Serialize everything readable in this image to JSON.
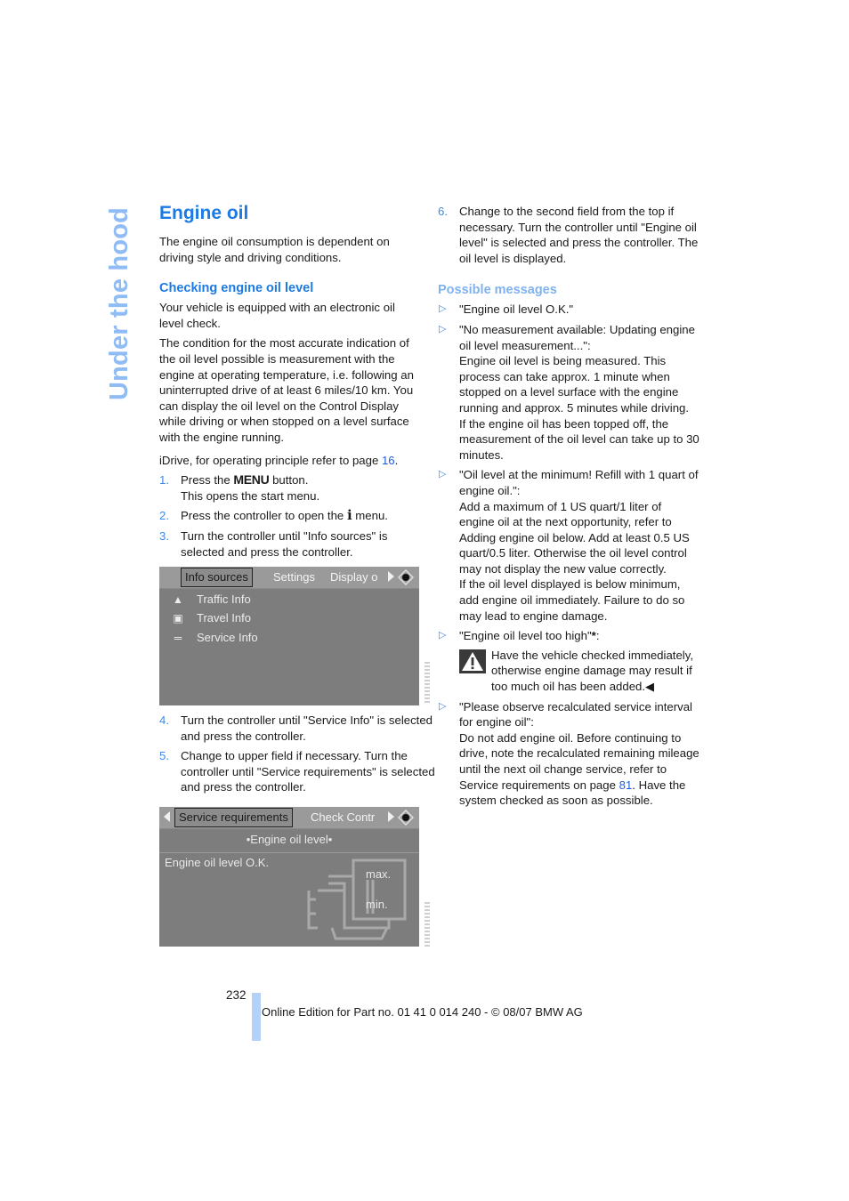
{
  "side_title": "Under the hood",
  "left": {
    "heading": "Engine oil",
    "intro": "The engine oil consumption is dependent on driving style and driving conditions.",
    "subheading": "Checking engine oil level",
    "para1": "Your vehicle is equipped with an electronic oil level check.",
    "para2": "The condition for the most accurate indication of the oil level possible is measurement with the engine at operating temperature, i.e. following an uninterrupted drive of at least 6 miles/10 km. You can display the oil level on the Control Display while driving or when stopped on a level surface with the engine running.",
    "idrive_text": "iDrive, for operating principle refer to page ",
    "idrive_page": "16",
    "idrive_end": ".",
    "steps": [
      {
        "num": "1.",
        "pre": "Press the ",
        "menu_word": "MENU",
        "post": " button.",
        "line2": "This opens the start menu."
      },
      {
        "num": "2.",
        "pre": "Press the controller to open the ",
        "icon": "i",
        "post": " menu."
      },
      {
        "num": "3.",
        "text": "Turn the controller until \"Info sources\" is selected and press the controller."
      },
      {
        "num": "4.",
        "text": "Turn the controller until \"Service Info\" is selected and press the controller."
      },
      {
        "num": "5.",
        "text": "Change to upper field if necessary. Turn the controller until \"Service requirements\" is selected and press the controller."
      }
    ]
  },
  "screen1": {
    "tabs": [
      "Info sources",
      "Settings",
      "Display o"
    ],
    "items": [
      {
        "icon": "traffic-info-icon",
        "label": "Traffic Info"
      },
      {
        "icon": "travel-info-icon",
        "label": "Travel Info"
      },
      {
        "icon": "service-info-icon",
        "label": "Service Info"
      }
    ]
  },
  "screen2": {
    "tabs": [
      "Service requirements",
      "Check Contr"
    ],
    "subtitle": "•Engine oil level•",
    "status": "Engine oil level O.K.",
    "gauge_max": "max.",
    "gauge_min": "min."
  },
  "right": {
    "step6": {
      "num": "6.",
      "text": "Change to the second field from the top if necessary. Turn the controller until \"Engine oil level\" is selected and press the controller. The oil level is displayed."
    },
    "subheading": "Possible messages",
    "bullet_glyph": "▷",
    "messages": [
      {
        "title": "\"Engine oil level O.K.\""
      },
      {
        "title": "\"No measurement available: Updating engine oil level measurement...\":",
        "body1": "Engine oil level is being measured. This process can take approx. 1 minute when stopped on a level surface with the engine running and approx. 5 minutes while driving.",
        "body2": "If the engine oil has been topped off, the measurement of the oil level can take up to 30 minutes."
      },
      {
        "title": "\"Oil level at the minimum! Refill with 1 quart of engine oil.\":",
        "body1": "Add a maximum of 1 US quart/1 liter of engine oil at the next opportunity, refer to Adding engine oil below. Add at least 0.5 US quart/0.5 liter. Otherwise the oil level control may not display the new value correctly.",
        "body2": "If the oil level displayed is below minimum, add engine oil immediately. Failure to do so may lead to engine damage."
      },
      {
        "title": "\"Engine oil level too high\"",
        "asterisk": "*",
        "colon": ":",
        "warning": "Have the vehicle checked immediately, otherwise engine damage may result if too much oil has been added.",
        "end_mark": "◀"
      },
      {
        "title": "\"Please observe recalculated service interval for engine oil\":",
        "body_pre": "Do not add engine oil. Before continuing to drive, note the recalculated remaining mileage until the next oil change service, refer to Service requirements on page ",
        "body_page": "81",
        "body_post": ". Have the system checked as soon as possible."
      }
    ]
  },
  "footer": {
    "page_number": "232",
    "text": "Online Edition for Part no. 01 41 0 014 240 - © 08/07 BMW AG"
  }
}
